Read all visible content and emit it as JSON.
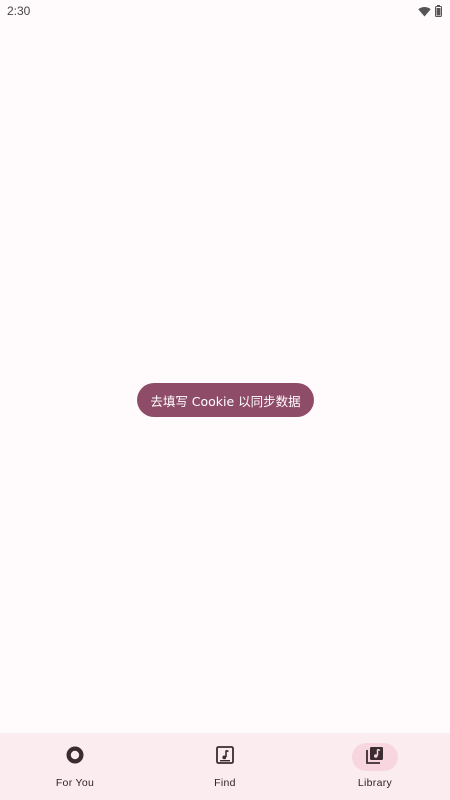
{
  "status_bar": {
    "time": "2:30",
    "icons": [
      "wifi-icon",
      "battery-icon"
    ]
  },
  "main": {
    "cookie_prompt": "去填写 Cookie 以同步数据"
  },
  "colors": {
    "accent": "#8f4c68",
    "nav_background": "#fbecef",
    "active_indicator": "#f8d6e0",
    "background": "#fffbfc"
  },
  "bottom_nav": {
    "items": [
      {
        "label": "For You",
        "icon": "for-you-icon",
        "active": false
      },
      {
        "label": "Find",
        "icon": "music-note-icon",
        "active": false
      },
      {
        "label": "Library",
        "icon": "library-music-icon",
        "active": true
      }
    ]
  }
}
